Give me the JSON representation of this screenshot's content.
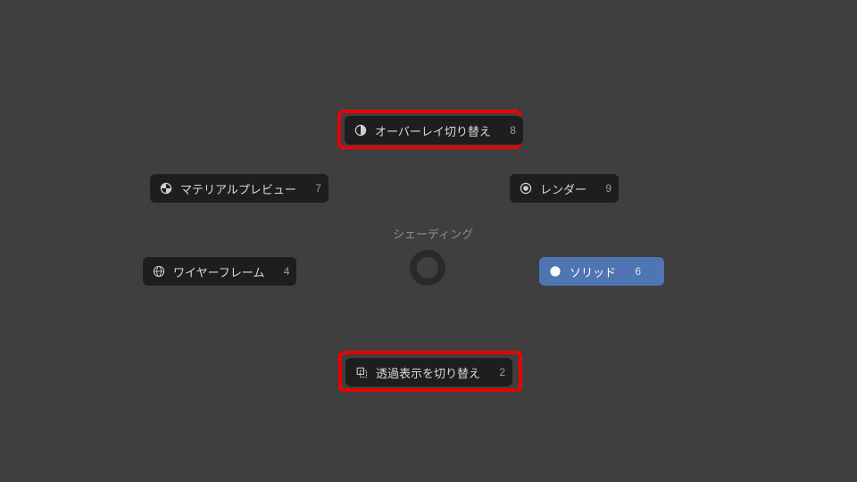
{
  "pie": {
    "title": "シェーディング",
    "items": [
      {
        "id": "toggle-overlays",
        "label": "オーバーレイ切り替え",
        "key": "8",
        "selected": false,
        "highlight": true,
        "icon": "overlay-icon"
      },
      {
        "id": "material-preview",
        "label": "マテリアルプレビュー",
        "key": "7",
        "selected": false,
        "highlight": false,
        "icon": "material-icon"
      },
      {
        "id": "rendered",
        "label": "レンダー",
        "key": "9",
        "selected": false,
        "highlight": false,
        "icon": "rendered-icon"
      },
      {
        "id": "wireframe",
        "label": "ワイヤーフレーム",
        "key": "4",
        "selected": false,
        "highlight": false,
        "icon": "wireframe-icon"
      },
      {
        "id": "solid",
        "label": "ソリッド",
        "key": "6",
        "selected": true,
        "highlight": false,
        "icon": "solid-icon"
      },
      {
        "id": "toggle-xray",
        "label": "透過表示を切り替え",
        "key": "2",
        "selected": false,
        "highlight": true,
        "icon": "xray-icon"
      }
    ]
  },
  "colors": {
    "bg": "#3f3f3f",
    "item_bg": "#1e1e1e",
    "selected_bg": "#4f76b3",
    "highlight": "#e60000"
  }
}
